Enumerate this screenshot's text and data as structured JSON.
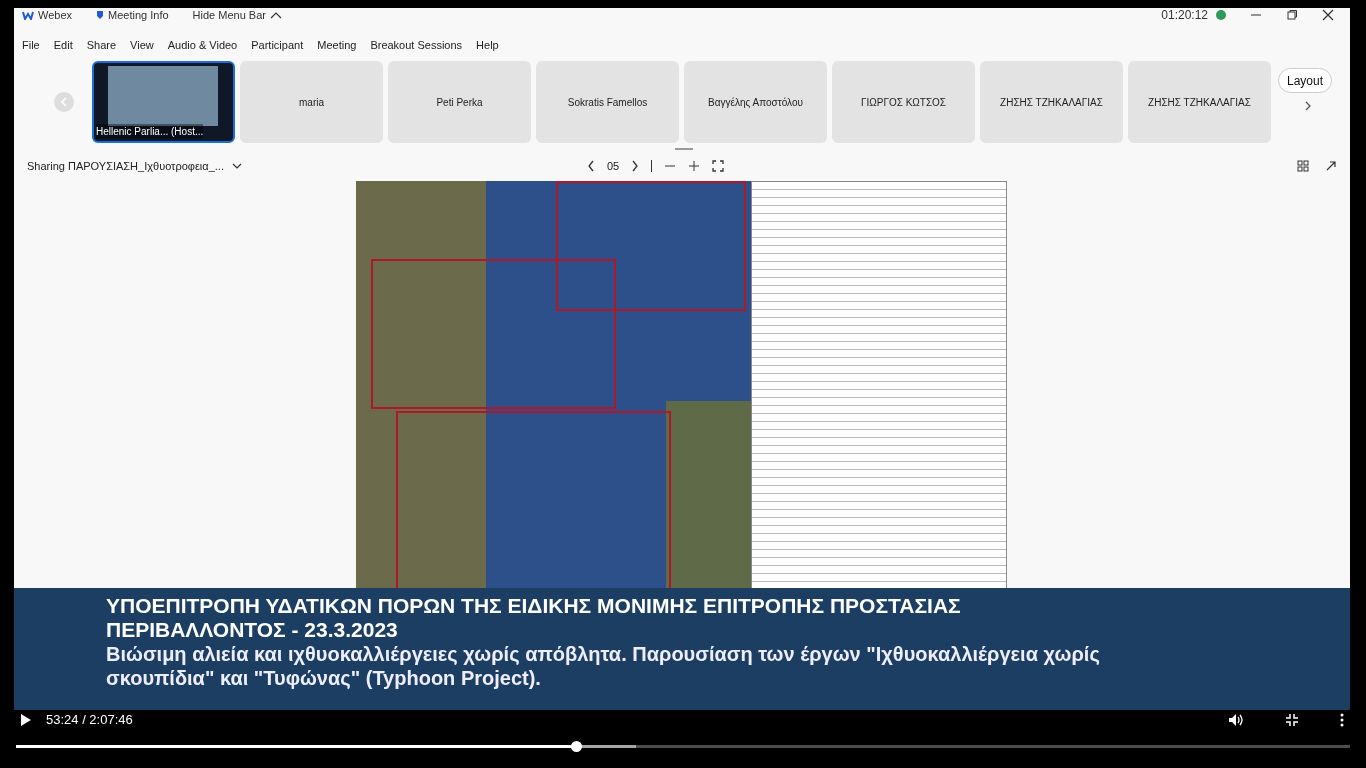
{
  "title_bar": {
    "app": "Webex",
    "meeting_info": "Meeting Info",
    "hide_menu": "Hide Menu Bar",
    "time": "01:20:12"
  },
  "menu": [
    "File",
    "Edit",
    "Share",
    "View",
    "Audio & Video",
    "Participant",
    "Meeting",
    "Breakout Sessions",
    "Help"
  ],
  "participants": [
    {
      "name": "Hellenic Parlia... (Host...",
      "kind": "video"
    },
    {
      "name": "maria",
      "kind": "name"
    },
    {
      "name": "Peti Perka",
      "kind": "name"
    },
    {
      "name": "Sokratis Famellos",
      "kind": "name"
    },
    {
      "name": "Βαγγέλης Αποστόλου",
      "kind": "name"
    },
    {
      "name": "ΓΙΩΡΓΟΣ ΚΩΤΣΟΣ",
      "kind": "name"
    },
    {
      "name": "ΖΗΣΗΣ ΤΖΗΚΑΛΑΓΙΑΣ",
      "kind": "name"
    },
    {
      "name": "ΖΗΣΗΣ ΤΖΗΚΑΛΑΓΙΑΣ",
      "kind": "name"
    }
  ],
  "layout_button": "Layout",
  "share_bar": {
    "label": "Sharing ΠΑΡΟΥΣΙΑΣΗ_Ιχθυοτροφεια_...",
    "page": "05"
  },
  "caption": {
    "title": "ΥΠΟΕΠΙΤΡΟΠΗ ΥΔΑΤΙΚΩΝ ΠΟΡΩΝ ΤΗΣ ΕΙΔΙΚΗΣ ΜΟΝΙΜΗΣ ΕΠΙΤΡΟΠΗΣ ΠΡΟΣΤΑΣΙΑΣ ΠΕΡΙΒΑΛΛΟΝΤΟΣ - 23.3.2023",
    "subtitle": "Βιώσιμη αλιεία και ιχθυοκαλλιέργειες χωρίς απόβλητα. Παρουσίαση των έργων \"Ιχθυοκαλλιέργεια χωρίς σκουπίδια\" και \"Τυφώνας\" (Typhoon Project)."
  },
  "player": {
    "time": "53:24 / 2:07:46",
    "progress": {
      "level": 0.42
    },
    "buffered": {
      "level": 0.465
    }
  }
}
